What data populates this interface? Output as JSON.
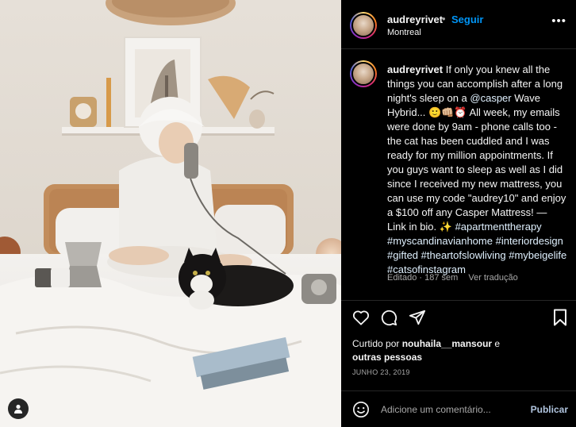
{
  "post": {
    "username": "audreyrivet",
    "dot": "•",
    "follow_label": "Seguir",
    "location": "Montreal",
    "more_label": "•••"
  },
  "caption": {
    "username": "audreyrivet",
    "text_1": " If only you knew all the things you can accomplish after a long night's sleep on a ",
    "mention": "@casper",
    "text_2": " Wave Hybrid... 🙂👊🏼⏰ All week, my emails were done by 9am - phone calls too - the cat has been cuddled and I was ready for my million appointments. If you guys want to sleep as well as I did since I received my new mattress, you can use my code \"audrey10\" and enjoy a $100 off any Casper Mattress! — Link in bio. ✨ ",
    "hashtags": [
      "#apartmenttherapy",
      "#myscandinavianhome",
      "#interiordesign",
      "#gifted",
      "#theartofslowliving",
      "#mybeigelife",
      "#catsofinstagram"
    ],
    "status": "Editado · 187 sem",
    "translate_label": "Ver tradução"
  },
  "actions": {
    "like_icon": "heart-icon",
    "comment_icon": "comment-icon",
    "share_icon": "share-icon",
    "save_icon": "bookmark-icon"
  },
  "likes": {
    "prefix": "Curtido por ",
    "user": "nouhaila__mansour",
    "suffix": " e",
    "others": "outras pessoas"
  },
  "date": "JUNHO 23, 2019",
  "comment": {
    "placeholder": "Adicione um comentário...",
    "publish_label": "Publicar"
  }
}
